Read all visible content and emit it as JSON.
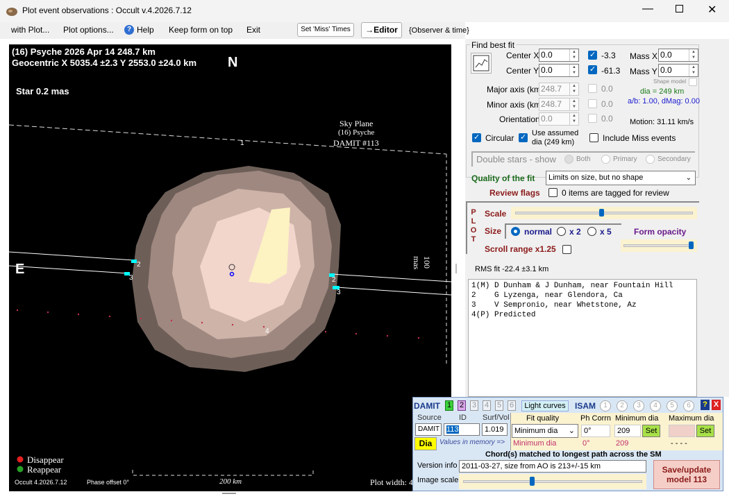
{
  "window": {
    "title": "Plot event observations : Occult v.4.2026.7.12"
  },
  "menu": {
    "with_plot": "with Plot...",
    "plot_options": "Plot options...",
    "help": "Help",
    "keep_on_top": "Keep form on top",
    "exit": "Exit",
    "set_miss": "Set 'Miss' Times",
    "editor": "→Editor",
    "observer_time": "{Observer & time}"
  },
  "plot": {
    "line1": "(16) Psyche  2026 Apr 14   248.7 km",
    "line2": "Geocentric  X  5035.4 ±2.3  Y 2553.0 ±24.0 km",
    "north": "N",
    "east": "E",
    "star": "Star 0.2 mas",
    "sky_plane": "Sky Plane",
    "sky_name": "(16) Psyche",
    "sky_model": "DAMIT #113",
    "scale_mas": "100 mas",
    "scale_km": "200 km",
    "legend_disappear": "Disappear",
    "legend_reappear": "Reappear",
    "version": "Occult 4.2026.7.12",
    "phase_offset": "Phase offset 0°",
    "plot_width": "Plot width: 4",
    "chord_labels": [
      "1",
      "2",
      "3",
      "2",
      "3",
      "4"
    ]
  },
  "fit": {
    "title": "Find best fit",
    "center_x_label": "Center X",
    "center_x": "0.0",
    "center_y_label": "Center Y",
    "center_y": "0.0",
    "cx_check": "-3.3",
    "cy_check": "-61.3",
    "mass_x_label": "Mass X",
    "mass_x": "0.0",
    "mass_y_label": "Mass Y",
    "mass_y": "0.0",
    "shape_model": "Shape model",
    "dia": "dia = 249 km",
    "ab": "a/b: 1.00, dMag: 0.00",
    "major_label": "Major axis (km)",
    "major": "248.7",
    "major_chk": "0.0",
    "minor_label": "Minor axis (km)",
    "minor": "248.7",
    "minor_chk": "0.0",
    "orient_label": "Orientation",
    "orient": "0.0",
    "orient_chk": "0.0",
    "motion": "Motion: 31.11 km/s",
    "circular": "Circular",
    "use_assumed": "Use assumed",
    "use_assumed2": "dia (249 km)",
    "include_miss": "Include Miss events",
    "double_stars": "Double stars - show",
    "both": "Both",
    "primary": "Primary",
    "secondary": "Secondary",
    "quality_label": "Quality of the fit",
    "quality_value": "Limits on size, but no shape",
    "review_flags": "Review flags",
    "review_text": "0 items are tagged for review"
  },
  "plotbox": {
    "p": "P",
    "l": "L",
    "o": "O",
    "t": "T",
    "scale": "Scale",
    "size": "Size",
    "normal": "normal",
    "x2": "x 2",
    "x5": "x 5",
    "form_opacity": "Form opacity",
    "scroll_range": "Scroll range x1.25"
  },
  "rms": "RMS fit -22.4 ±3.1 km",
  "observers": [
    "1(M) D Dunham & J Dunham, near Fountain Hill",
    "2    G Lyzenga, near Glendora, Ca",
    "3    V Sempronio, near Whetstone, Az",
    "4(P) Predicted"
  ],
  "damit": {
    "damit": "DAMIT",
    "nums": [
      "1",
      "2",
      "3",
      "4",
      "5",
      "6"
    ],
    "light_curves": "Light curves",
    "isam": "ISAM",
    "help": "?",
    "close": "X",
    "source_label": "Source",
    "id_label": "ID",
    "surf_label": "Surf/Vol",
    "source": "DAMIT",
    "id": "113",
    "surf": "1.019",
    "dia_btn": "Dia",
    "values_memory": "Values in memory =>",
    "fit_quality_label": "Fit quality",
    "fit_quality": "Minimum dia",
    "fit_quality_mem": "Minimum dia",
    "ph_corrn_label": "Ph Corrn",
    "ph_corrn": "0°",
    "ph_corrn_mem": "0°",
    "min_dia_label": "Minimum dia",
    "min_dia": "209",
    "min_dia_mem": "209",
    "max_dia_label": "Maximum dia",
    "max_dia_mem": "- - - -",
    "set": "Set",
    "chords_matched": "Chord(s) matched to longest path across the SM",
    "version_label": "Version info",
    "version_info": "2011-03-27, size from AO is 213+/-15 km",
    "image_scale": "Image scale",
    "save_update": "Save/update",
    "model_113": "model 113"
  }
}
